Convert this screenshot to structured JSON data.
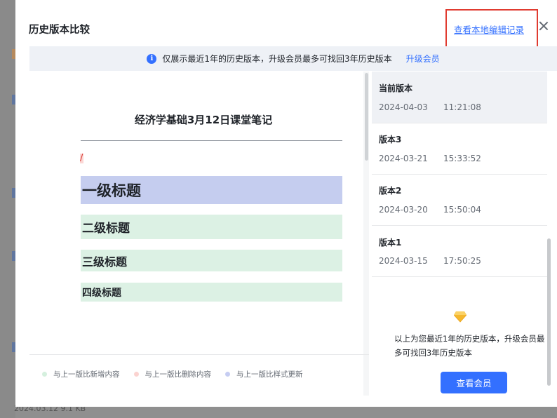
{
  "dialog": {
    "title": "历史版本比较",
    "local_log_link": "查看本地编辑记录"
  },
  "notice": {
    "icon": "info-icon",
    "text": "仅展示最近1年的历史版本，升级会员最多可找回3年历史版本",
    "link": "升级会员"
  },
  "document": {
    "title": "经济学基础3月12日课堂笔记",
    "deleted_mark": "/",
    "headings": [
      "一级标题",
      "二级标题",
      "三级标题",
      "四级标题"
    ]
  },
  "legend": [
    {
      "label": "与上一版比新增内容",
      "color": "#d5f0de"
    },
    {
      "label": "与上一版比删除内容",
      "color": "#fbd3d0"
    },
    {
      "label": "与上一版比样式更新",
      "color": "#c6cdf2"
    }
  ],
  "versions": [
    {
      "name": "当前版本",
      "date": "2024-04-03",
      "time": "11:21:08",
      "active": true
    },
    {
      "name": "版本3",
      "date": "2024-03-21",
      "time": "15:33:52",
      "active": false
    },
    {
      "name": "版本2",
      "date": "2024-03-20",
      "time": "15:50:04",
      "active": false
    },
    {
      "name": "版本1",
      "date": "2024-03-15",
      "time": "17:50:25",
      "active": false
    }
  ],
  "upsell": {
    "icon": "diamond-icon",
    "text": "以上为您最近1年的历史版本，升级会员最多可找回3年历史版本",
    "button": "查看会员"
  },
  "background": {
    "bottom_text": "2024.03.12   9.1 KB"
  },
  "colors": {
    "accent": "#3370ff",
    "highlight_box": "#e03b30"
  }
}
